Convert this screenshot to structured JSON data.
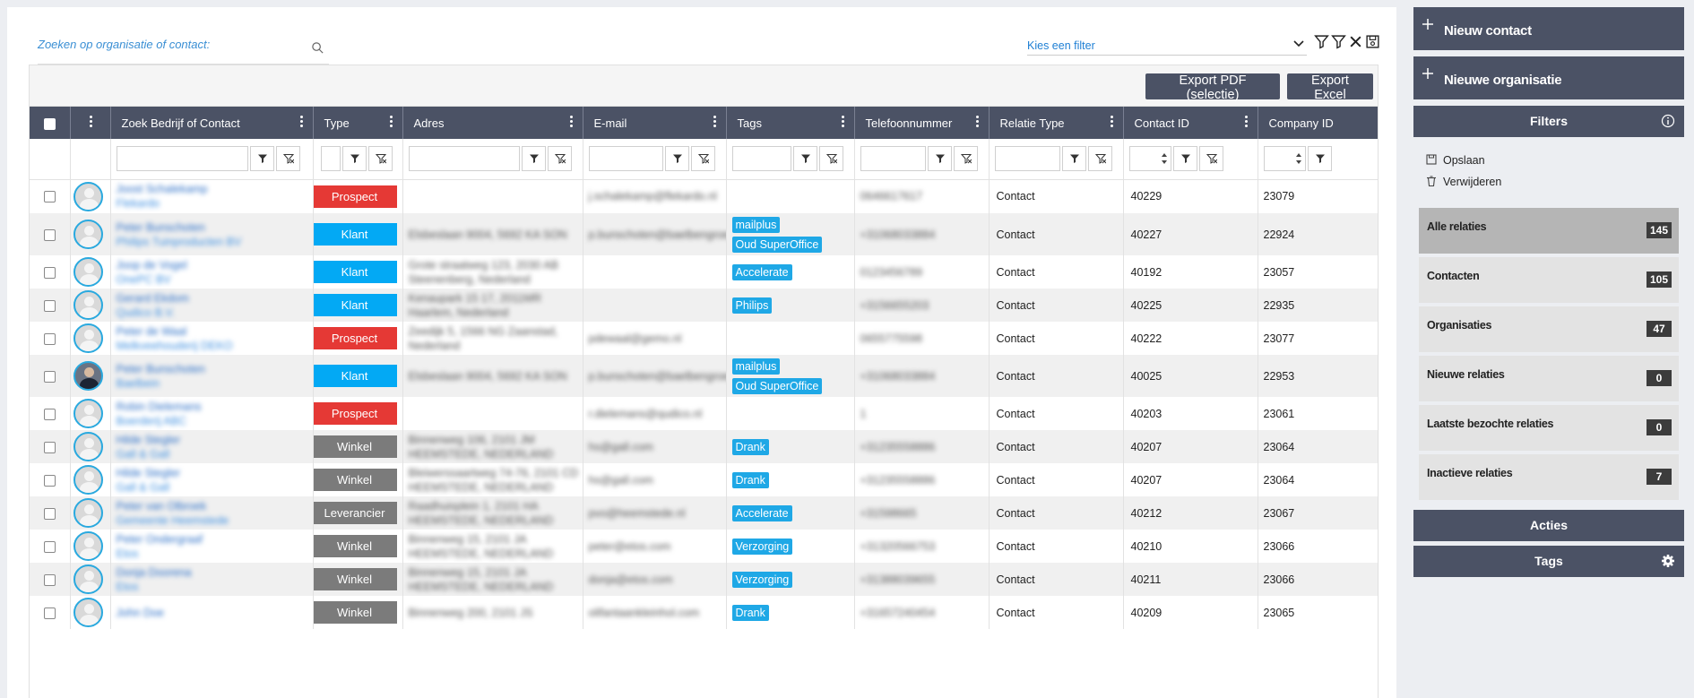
{
  "search": {
    "placeholder": "Zoeken op organisatie of contact:"
  },
  "filter_select": {
    "value": "Kies een filter"
  },
  "toolbar": {
    "export_pdf": "Export PDF (selectie)",
    "export_excel": "Export Excel"
  },
  "columns": [
    "Zoek Bedrijf of Contact",
    "Type",
    "Adres",
    "E-mail",
    "Tags",
    "Telefoonnummer",
    "Relatie Type",
    "Contact ID",
    "Company ID"
  ],
  "rows": [
    {
      "name": "Joost Schalekamp",
      "org": "Flekardo",
      "type": "Prospect",
      "address": [
        "",
        ""
      ],
      "email": "j.schalekamp@flekardo.nl",
      "tags": [],
      "phone": "0646617617",
      "relation": "Contact",
      "contact_id": "40229",
      "company_id": "23079"
    },
    {
      "name": "Peter Bunschoten",
      "org": "Philips Tuinproducten BV",
      "type": "Klant",
      "address": [
        "Elsbeslaan 9004, 5692 KA SON",
        ""
      ],
      "email": "p.bunschoten@baelbengroep.nl",
      "tags": [
        "mailplus",
        "Oud SuperOffice"
      ],
      "phone": "+31068033884",
      "relation": "Contact",
      "contact_id": "40227",
      "company_id": "22924"
    },
    {
      "name": "Joop de Vogel",
      "org": "OnePC BV",
      "type": "Klant",
      "address": [
        "Grote straatweg 123, 2030 AB",
        "Steenenberg, Nederland"
      ],
      "email": "",
      "tags": [
        "Accelerate"
      ],
      "phone": "0123456789",
      "relation": "Contact",
      "contact_id": "40192",
      "company_id": "23057"
    },
    {
      "name": "Gerard Ekdom",
      "org": "Qudico B.V.",
      "type": "Klant",
      "address": [
        "Kenaupark 15 17, 2011MR",
        "Haarlem, Nederland"
      ],
      "email": "",
      "tags": [
        "Philips"
      ],
      "phone": "+3156655203",
      "relation": "Contact",
      "contact_id": "40225",
      "company_id": "22935"
    },
    {
      "name": "Peter de Waal",
      "org": "Melkveehouderij DEKO",
      "type": "Prospect",
      "address": [
        "Zeedijk 5, 1566 NG Zaanstad,",
        "Nederland"
      ],
      "email": "pdewaal@gemo.nl",
      "tags": [],
      "phone": "0655775598",
      "relation": "Contact",
      "contact_id": "40222",
      "company_id": "23077"
    },
    {
      "name": "Peter Bunschoten",
      "org": "Baelbein",
      "type": "Klant",
      "address": [
        "Elsbeslaan 9004, 5692 KA SON",
        ""
      ],
      "email": "p.bunschoten@baelbengroep.nl",
      "tags": [
        "mailplus",
        "Oud SuperOffice"
      ],
      "phone": "+31068033884",
      "relation": "Contact",
      "contact_id": "40025",
      "company_id": "22953"
    },
    {
      "name": "Robin Dielemans",
      "org": "Boerderij ABC",
      "type": "Prospect",
      "address": [
        "",
        ""
      ],
      "email": "r.dielemans@qudico.nl",
      "tags": [],
      "phone": "1",
      "relation": "Contact",
      "contact_id": "40203",
      "company_id": "23061"
    },
    {
      "name": "Hilde Stegler",
      "org": "Gall & Gall",
      "type": "Winkel",
      "address": [
        "Binnenweg 106, 2101 JM",
        "HEEMSTEDE, NEDERLAND"
      ],
      "email": "hs@gall.com",
      "tags": [
        "Drank"
      ],
      "phone": "+31235558886",
      "relation": "Contact",
      "contact_id": "40207",
      "company_id": "23064"
    },
    {
      "name": "Hilde Stegler",
      "org": "Gall & Gall",
      "type": "Winkel",
      "address": [
        "Bleiwerssaartweg 74-76, 2101 CD",
        "HEEMSTEDE, NEDERLAND"
      ],
      "email": "hs@gall.com",
      "tags": [
        "Drank"
      ],
      "phone": "+31235558886",
      "relation": "Contact",
      "contact_id": "40207",
      "company_id": "23064"
    },
    {
      "name": "Peter van Olbroek",
      "org": "Gemeente Heemstede",
      "type": "Leverancier",
      "address": [
        "Raadhuisplein 1, 2101 HA",
        "HEEMSTEDE, NEDERLAND"
      ],
      "email": "pvo@heemstede.nl",
      "tags": [
        "Accelerate"
      ],
      "phone": "+31598665",
      "relation": "Contact",
      "contact_id": "40212",
      "company_id": "23067"
    },
    {
      "name": "Peter Ondergraaf",
      "org": "Etos",
      "type": "Winkel",
      "address": [
        "Binnenweg 15, 2101 JA",
        "HEEMSTEDE, NEDERLAND"
      ],
      "email": "peter@etos.com",
      "tags": [
        "Verzorging"
      ],
      "phone": "+31320566753",
      "relation": "Contact",
      "contact_id": "40210",
      "company_id": "23066"
    },
    {
      "name": "Donja Doorena",
      "org": "Etos",
      "type": "Winkel",
      "address": [
        "Binnenweg 15, 2101 JA",
        "HEEMSTEDE, NEDERLAND"
      ],
      "email": "donja@etos.com",
      "tags": [
        "Verzorging"
      ],
      "phone": "+31388039655",
      "relation": "Contact",
      "contact_id": "40211",
      "company_id": "23066"
    },
    {
      "name": "John Doe",
      "org": "",
      "type": "Winkel",
      "address": [
        "Binnenweg 200, 2101 JS",
        ""
      ],
      "email": "olifantaankleinhol.com",
      "tags": [
        "Drank"
      ],
      "phone": "+31657240454",
      "relation": "Contact",
      "contact_id": "40209",
      "company_id": "23065"
    }
  ],
  "sidebar": {
    "new_contact": "Nieuw contact",
    "new_org": "Nieuwe organisatie",
    "filters_title": "Filters",
    "save": "Opslaan",
    "delete": "Verwijderen",
    "filter_items": [
      {
        "label": "Alle relaties",
        "count": "145"
      },
      {
        "label": "Contacten",
        "count": "105"
      },
      {
        "label": "Organisaties",
        "count": "47"
      },
      {
        "label": "Nieuwe relaties",
        "count": "0"
      },
      {
        "label": "Laatste bezochte relaties",
        "count": "0"
      },
      {
        "label": "Inactieve relaties",
        "count": "7"
      }
    ],
    "acties": "Acties",
    "tags": "Tags"
  },
  "colors": {
    "header": "#4b5265",
    "prospect": "#e53935",
    "klant": "#03a9f4",
    "winkel": "#7b7b7b",
    "tag": "#1fa8e6"
  }
}
